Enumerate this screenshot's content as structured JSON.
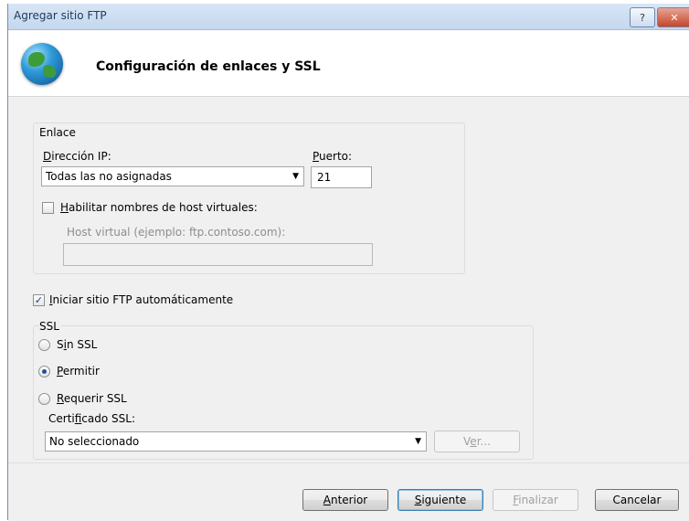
{
  "window": {
    "title": "Agregar sitio FTP",
    "help_label": "?",
    "close_label": "✕"
  },
  "header": {
    "icon": "globe-icon",
    "title": "Configuración de enlaces y SSL"
  },
  "binding": {
    "group_label": "Enlace",
    "ip_label": "Dirección IP:",
    "ip_value": "Todas las no asignadas",
    "port_label": "Puerto:",
    "port_value": "21",
    "virtual_host_checkbox_label": "Habilitar nombres de host virtuales:",
    "virtual_host_checked": false,
    "virtual_host_field_label": "Host virtual (ejemplo: ftp.contoso.com):",
    "virtual_host_value": ""
  },
  "autostart": {
    "label": "Iniciar sitio FTP automáticamente",
    "checked": true
  },
  "ssl": {
    "group_label": "SSL",
    "options": [
      {
        "label": "Sin SSL",
        "selected": false
      },
      {
        "label": "Permitir",
        "selected": true
      },
      {
        "label": "Requerir SSL",
        "selected": false
      }
    ],
    "certificate_label": "Certificado SSL:",
    "certificate_value": "No seleccionado",
    "view_button": "Ver..."
  },
  "footer": {
    "back": "Anterior",
    "next": "Siguiente",
    "finish": "Finalizar",
    "cancel": "Cancelar"
  }
}
